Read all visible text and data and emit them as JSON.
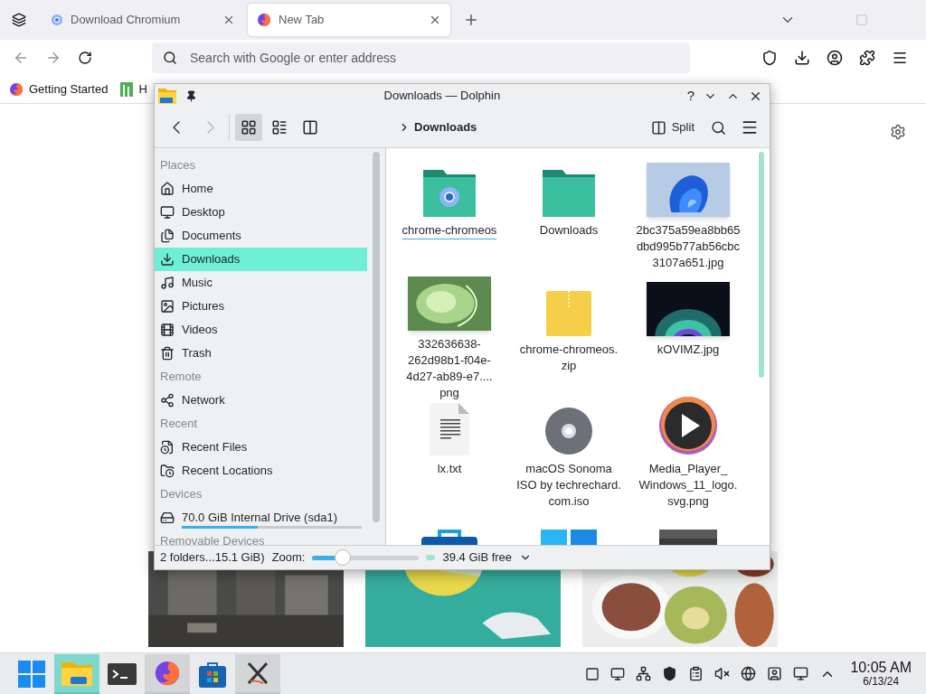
{
  "browser": {
    "tabs": [
      {
        "title": "Download Chromium",
        "kind": "chromium",
        "selected": false
      },
      {
        "title": "New Tab",
        "kind": "firefox",
        "selected": true
      }
    ],
    "address_bar": {
      "placeholder": "Search with Google or enter address"
    },
    "bookmarks": [
      {
        "label": "Getting Started",
        "kind": "firefox"
      },
      {
        "label": "H",
        "kind": "green"
      }
    ]
  },
  "dolphin": {
    "title": "Downloads — Dolphin",
    "help_label": "?",
    "view_modes": [
      {
        "kind": "icons",
        "selected": true
      },
      {
        "kind": "compact",
        "selected": false
      },
      {
        "kind": "tree",
        "selected": false
      }
    ],
    "breadcrumb": "Downloads",
    "split_label": "Split",
    "sidebar": [
      {
        "title": "Places",
        "items": [
          {
            "label": "Home",
            "kind": "home",
            "selected": false
          },
          {
            "label": "Desktop",
            "kind": "desktop",
            "selected": false
          },
          {
            "label": "Documents",
            "kind": "documents",
            "selected": false
          },
          {
            "label": "Downloads",
            "kind": "downloads",
            "selected": true
          },
          {
            "label": "Music",
            "kind": "music",
            "selected": false
          },
          {
            "label": "Pictures",
            "kind": "pictures",
            "selected": false
          },
          {
            "label": "Videos",
            "kind": "videos",
            "selected": false
          },
          {
            "label": "Trash",
            "kind": "trash",
            "selected": false
          }
        ]
      },
      {
        "title": "Remote",
        "items": [
          {
            "label": "Network",
            "kind": "network",
            "selected": false
          }
        ]
      },
      {
        "title": "Recent",
        "items": [
          {
            "label": "Recent Files",
            "kind": "recent-files",
            "selected": false
          },
          {
            "label": "Recent Locations",
            "kind": "recent-locations",
            "selected": false
          }
        ]
      },
      {
        "title": "Devices",
        "items": [
          {
            "label": "70.0 GiB Internal Drive (sda1)",
            "kind": "drive",
            "level": 0.42,
            "selected": false
          }
        ]
      },
      {
        "title": "Removable Devices"
      }
    ],
    "items": [
      {
        "name": "chrome-chromeos",
        "kind": "app-folder",
        "selected": true
      },
      {
        "name": "Downloads",
        "kind": "folder",
        "selected": false
      },
      {
        "name": "2bc375a59ea8bb65dbd995b77ab56cbc3107a651.jpg",
        "selected": false
      },
      {
        "name": "332636638-262d98b1-f04e-4d27-ab89-e7.... png",
        "selected": false
      },
      {
        "name": "chrome-chromeos. zip",
        "kind": "archive",
        "selected": false
      },
      {
        "name": "kOVIMZ.jpg",
        "selected": false
      },
      {
        "name": "lx.txt",
        "kind": "text",
        "selected": false
      },
      {
        "name": "macOS Sonoma ISO by techrechard. com.iso",
        "kind": "disc",
        "selected": false
      },
      {
        "name": "Media_Player_ Windows_11_logo. svg.png",
        "kind": "media",
        "selected": false
      },
      {
        "kind": "toolbox"
      },
      {
        "kind": "tiles"
      },
      {
        "kind": "terminal"
      }
    ],
    "status": {
      "summary": "2 folders...15.1 GiB)",
      "zoom_label": "Zoom:",
      "zoom": {
        "level": 0.28
      },
      "free_space": "39.4 GiB free"
    }
  },
  "taskbar": {
    "apps": [
      {
        "kind": "start",
        "active": false,
        "running": false
      },
      {
        "kind": "files",
        "active": true,
        "running": true
      },
      {
        "kind": "terminal",
        "active": false,
        "running": false
      },
      {
        "kind": "firefox",
        "active": false,
        "running": true
      },
      {
        "kind": "store",
        "active": false,
        "running": false
      },
      {
        "kind": "x",
        "active": false,
        "running": true
      }
    ],
    "time": "10:05 AM",
    "date": "6/13/24"
  }
}
